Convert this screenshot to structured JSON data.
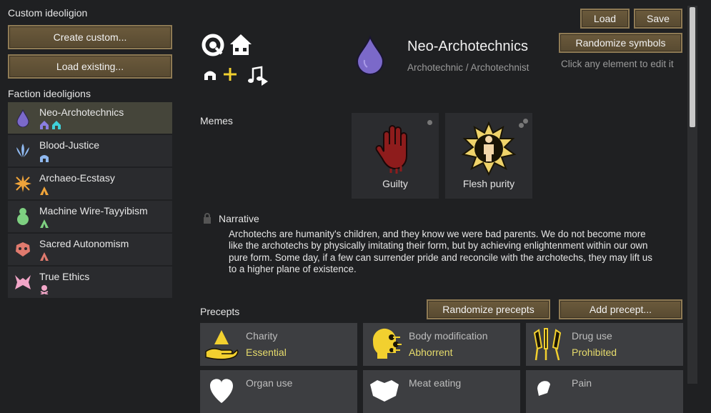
{
  "left_panel": {
    "custom_title": "Custom ideoligion",
    "create_label": "Create custom...",
    "load_existing_label": "Load existing...",
    "faction_title": "Faction ideoligions",
    "factions": [
      {
        "name": "Neo-Archotechnics",
        "icon": "droplet-icon",
        "color": "#7b69c9"
      },
      {
        "name": "Blood-Justice",
        "icon": "flame-wings-icon",
        "color": "#8fb8ef"
      },
      {
        "name": "Archaeo-Ecstasy",
        "icon": "star-burst-icon",
        "color": "#f0a43a"
      },
      {
        "name": "Machine Wire-Tayyibism",
        "icon": "figure-icon",
        "color": "#7ed081"
      },
      {
        "name": "Sacred Autonomism",
        "icon": "mask-icon",
        "color": "#e07a6e"
      },
      {
        "name": "True Ethics",
        "icon": "horned-icon",
        "color": "#f2a6c8"
      }
    ]
  },
  "header": {
    "title": "Neo-Archotechnics",
    "subtitle": "Archotechnic / Archotechnist",
    "hint": "Click any element to edit it",
    "load_label": "Load",
    "save_label": "Save",
    "randomize_symbols_label": "Randomize symbols",
    "accent": "#7b69c9"
  },
  "memes": {
    "title": "Memes",
    "items": [
      {
        "label": "Guilty",
        "icon": "bloody-hand-icon"
      },
      {
        "label": "Flesh purity",
        "icon": "sun-figure-icon"
      }
    ]
  },
  "narrative": {
    "title": "Narrative",
    "text": "Archotechs are humanity's children, and they know we were bad parents. We do not become more like the archotechs by physically imitating their form, but by achieving enlightenment within our own pure form. Some day, if a few can surrender pride and reconcile with the archotechs, they may lift us to a higher plane of existence."
  },
  "precepts": {
    "title": "Precepts",
    "randomize_label": "Randomize precepts",
    "add_label": "Add precept...",
    "value_color": "#e7dc6c",
    "items": [
      {
        "name": "Charity",
        "value": "Essential",
        "icon": "hand-pyramid-icon"
      },
      {
        "name": "Body modification",
        "value": "Abhorrent",
        "icon": "cyborg-head-icon"
      },
      {
        "name": "Drug use",
        "value": "Prohibited",
        "icon": "syringes-icon"
      },
      {
        "name": "Organ use",
        "value": "",
        "icon": "organ-icon"
      },
      {
        "name": "Meat eating",
        "value": "",
        "icon": "skull-icon"
      },
      {
        "name": "Pain",
        "value": "",
        "icon": "pain-icon"
      }
    ]
  }
}
